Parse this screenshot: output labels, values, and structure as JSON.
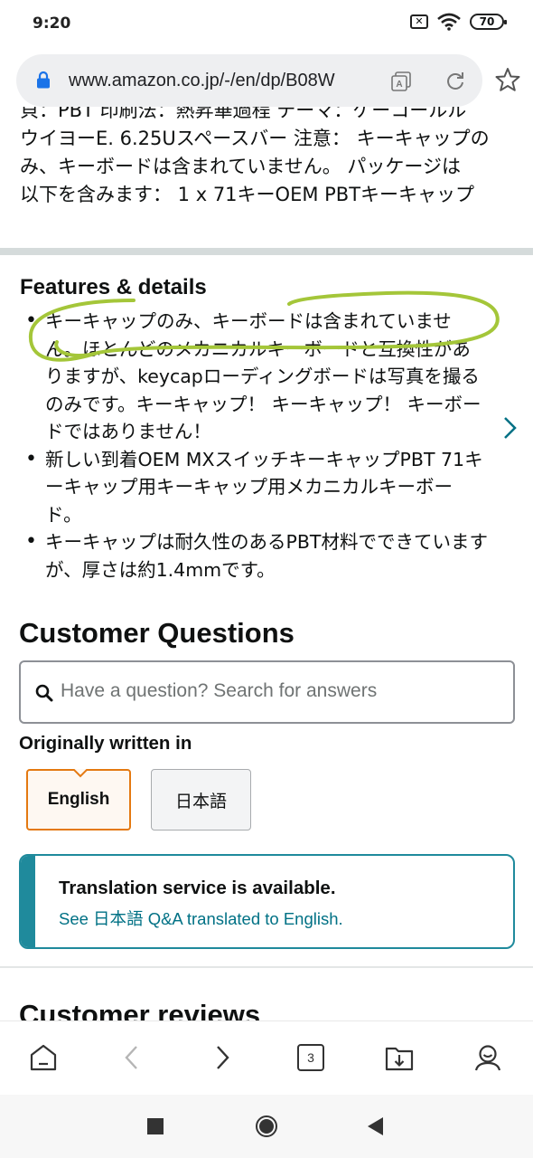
{
  "status_bar": {
    "time": "9:20",
    "battery": "70",
    "icons": [
      "sim-off-icon",
      "wifi-icon",
      "battery-icon"
    ]
  },
  "browser": {
    "url": "www.amazon.co.jp/-/en/dp/B08W",
    "tab_count": "3",
    "icons": [
      "lock-icon",
      "translate-icon",
      "reload-icon",
      "star-icon",
      "home-icon",
      "back-icon",
      "forward-icon",
      "tabs-icon",
      "downloads-icon",
      "profile-icon"
    ]
  },
  "product": {
    "description_lines": [
      "貝：PBT 印刷法：熱昇華過程 テーマ：ケーコールル",
      "ウイヨーE. 6.25Uスペースバー 注意： キーキャップの",
      "み、キーボードは含まれていません。 パッケージは",
      "以下を含みます： 1 x 71キーOEM PBTキーキャップ"
    ]
  },
  "features": {
    "title": "Features & details",
    "items": [
      "キーキャップのみ、キーボードは含まれていません。ほとんどのメカニカルキーボードと互換性がありますが、keycapローディングボードは写真を撮るのみです。キーキャップ！ キーキャップ！ キーボードではありません！",
      "新しい到着OEM MXスイッチキーキャップPBT 71キーキャップ用キーキャップ用メカニカルキーボード。",
      "キーキャップは耐久性のあるPBT材料でできていますが、厚さは約1.4mmです。"
    ]
  },
  "customer_questions": {
    "title": "Customer Questions",
    "search_placeholder": "Have a question? Search for answers",
    "written_in_label": "Originally written in",
    "languages": [
      "English",
      "日本語"
    ],
    "selected_language": "English",
    "translation_notice": {
      "title": "Translation service is available.",
      "link": "See 日本語 Q&A translated to English."
    }
  },
  "reviews": {
    "title": "Customer reviews"
  },
  "colors": {
    "accent_teal": "#1f8a9c",
    "link": "#007185",
    "selected_border": "#e47911",
    "annotation_green": "#a4c639"
  }
}
